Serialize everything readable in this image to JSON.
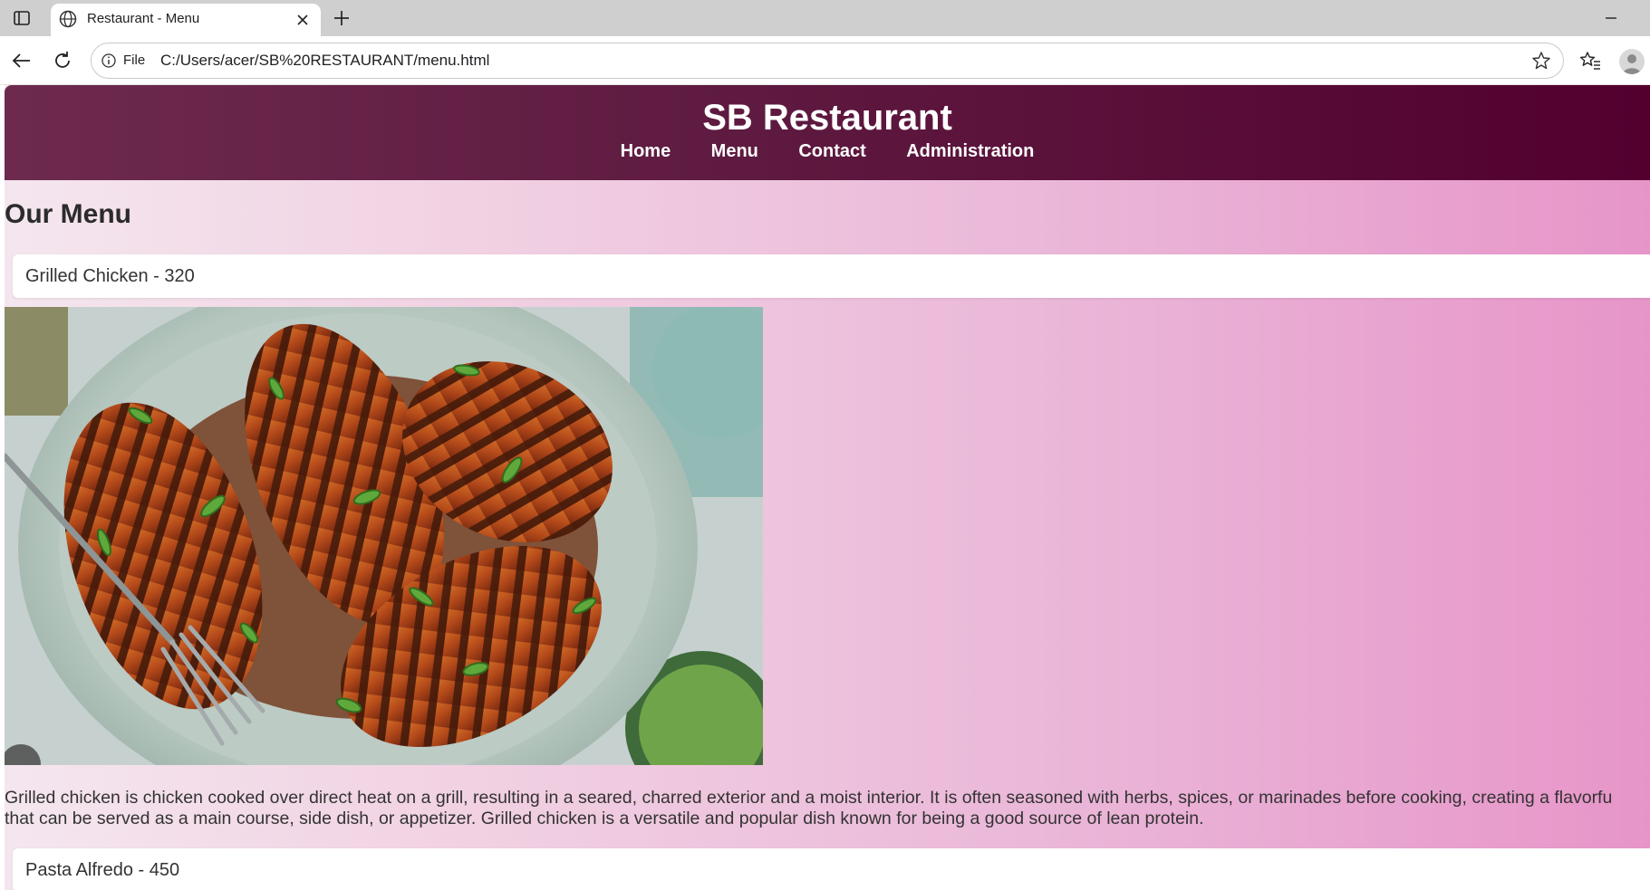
{
  "browser": {
    "tab_title": "Restaurant - Menu",
    "address_prefix": "File",
    "url": "C:/Users/acer/SB%20RESTAURANT/menu.html"
  },
  "site": {
    "title": "SB Restaurant",
    "nav": [
      "Home",
      "Menu",
      "Contact",
      "Administration"
    ]
  },
  "menu": {
    "heading": "Our Menu",
    "items": [
      {
        "label": "Grilled Chicken - 320",
        "image_alt": "grilled-chicken-photo",
        "description_lines": [
          "Grilled chicken is chicken cooked over direct heat on a grill, resulting in a seared, charred exterior and a moist interior. It is often seasoned with herbs, spices, or marinades before cooking, creating a flavorfu",
          "that can be served as a main course, side dish, or appetizer. Grilled chicken is a versatile and popular dish known for being a good source of lean protein."
        ]
      },
      {
        "label": "Pasta Alfredo - 450"
      }
    ]
  },
  "colors": {
    "header_start": "#6d2a4e",
    "header_end": "#53002f",
    "page_gradient_start": "#f4e6ee",
    "page_gradient_end": "#e795c9"
  }
}
